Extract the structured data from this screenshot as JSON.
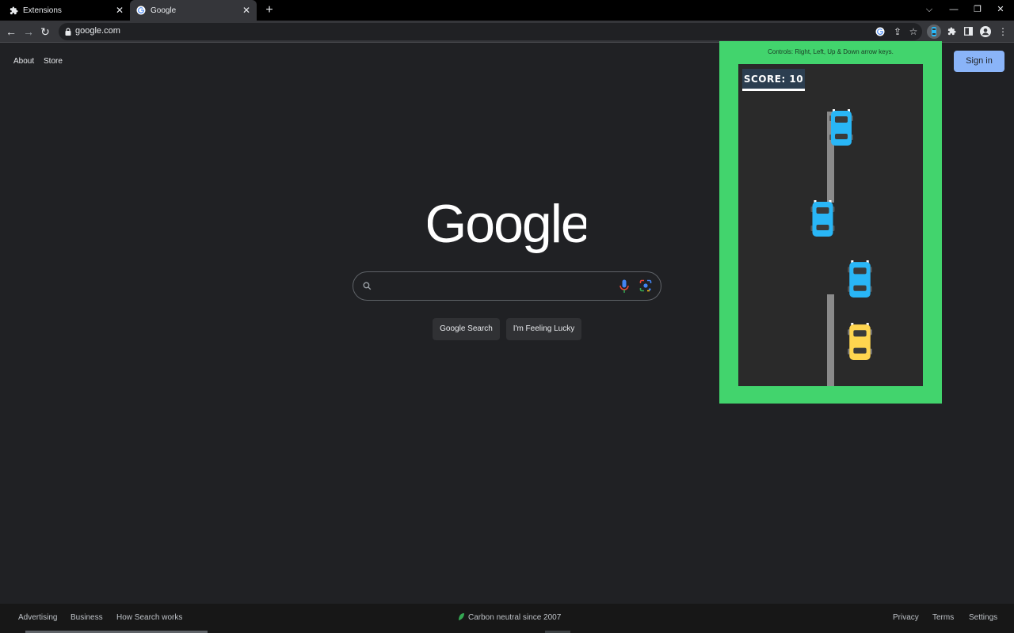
{
  "browser": {
    "tabs": [
      {
        "title": "Extensions",
        "icon": "puzzle-icon"
      },
      {
        "title": "Google",
        "icon": "google-g-icon",
        "active": true
      }
    ],
    "url": "google.com"
  },
  "page": {
    "top_links": [
      "About",
      "Store"
    ],
    "sign_in_label": "Sign in",
    "logo_text": "Google",
    "search": {
      "value": ""
    },
    "buttons": {
      "search": "Google Search",
      "lucky": "I'm Feeling Lucky"
    },
    "footer": {
      "left": [
        "Advertising",
        "Business",
        "How Search works"
      ],
      "center": "Carbon neutral since 2007",
      "right": [
        "Privacy",
        "Terms",
        "Settings"
      ]
    }
  },
  "game": {
    "controls_text": "Controls: Right, Left, Up & Down arrow keys.",
    "score_text": "SCORE: 10",
    "colors": {
      "frame": "#42d46d",
      "road": "#2a2a2a",
      "enemy_car": "#29b6f6",
      "player_car": "#ffd54f"
    }
  }
}
